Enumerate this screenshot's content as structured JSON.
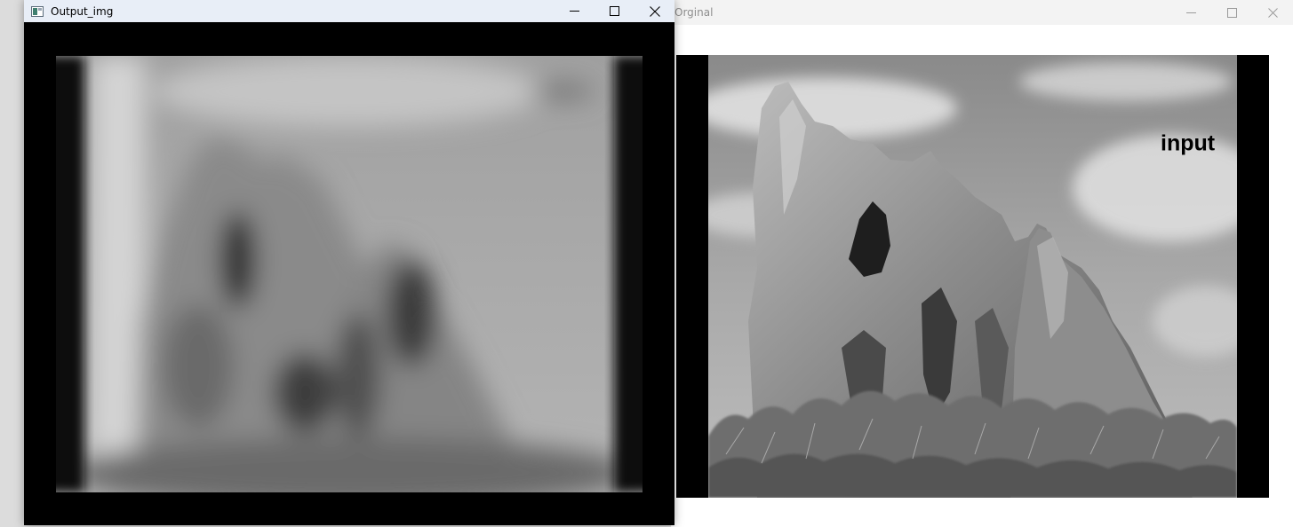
{
  "windows": {
    "original": {
      "title": "Orginal",
      "controls": {
        "minimize_icon": "minimize-icon",
        "maximize_icon": "maximize-icon",
        "close_icon": "close-icon"
      },
      "image_overlay_text": "input"
    },
    "output": {
      "title": "Output_img",
      "controls": {
        "minimize_icon": "minimize-icon",
        "maximize_icon": "maximize-icon",
        "close_icon": "close-icon"
      }
    }
  },
  "colors": {
    "output_titlebar": "#e8eef7",
    "original_titlebar": "#f3f3f3",
    "canvas_background": "#000000"
  }
}
